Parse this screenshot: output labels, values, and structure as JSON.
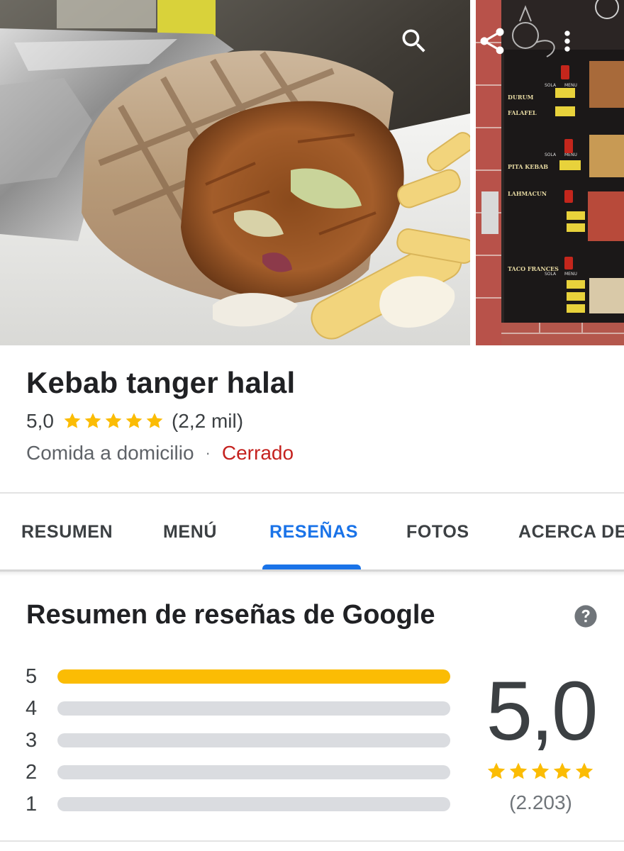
{
  "place": {
    "name": "Kebab tanger halal",
    "rating": "5,0",
    "rating_value": 5,
    "review_count_short": "(2,2 mil)",
    "category": "Comida a domicilio",
    "separator": "·",
    "status": "Cerrado",
    "status_color": "#c5221f"
  },
  "hero": {
    "main_photo": "doner-kebab-wrap-photo",
    "side_photo": "menu-board-photo",
    "menu_board_text": [
      "DURUM",
      "FALAFEL",
      "PITA KEBAB",
      "LAHMACUN",
      "TACO FRANCES",
      "SOLA",
      "MENU"
    ],
    "actions": [
      "search-icon",
      "share-icon",
      "more-vert-icon"
    ]
  },
  "tabs": [
    {
      "label": "RESUMEN",
      "active": false
    },
    {
      "label": "MENÚ",
      "active": false
    },
    {
      "label": "RESEÑAS",
      "active": true
    },
    {
      "label": "FOTOS",
      "active": false
    },
    {
      "label": "ACERCA DE",
      "active": false
    }
  ],
  "reviews_summary": {
    "title": "Resumen de reseñas de Google",
    "help_icon": "help-circle-icon",
    "score": "5,0",
    "score_value": 5,
    "total_reviews": "(2.203)",
    "distribution": [
      {
        "label": "5",
        "fraction": 1.0
      },
      {
        "label": "4",
        "fraction": 0
      },
      {
        "label": "3",
        "fraction": 0
      },
      {
        "label": "2",
        "fraction": 0
      },
      {
        "label": "1",
        "fraction": 0
      }
    ]
  },
  "colors": {
    "accent": "#1a73e8",
    "star": "#fbbc04",
    "track": "#dadce0",
    "text": "#202124",
    "muted": "#5f6368"
  }
}
